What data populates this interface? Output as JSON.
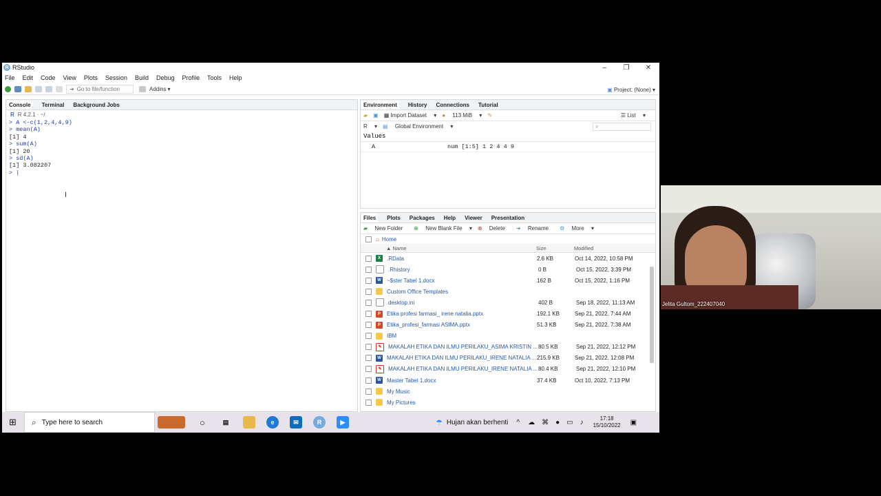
{
  "app": {
    "title": "RStudio",
    "window_controls": [
      "–",
      "❐",
      "✕"
    ],
    "menu": [
      "File",
      "Edit",
      "Code",
      "View",
      "Plots",
      "Session",
      "Build",
      "Debug",
      "Profile",
      "Tools",
      "Help"
    ],
    "toolbar": {
      "go_to_file": "Go to file/function",
      "addins": "Addins",
      "project": "Project: (None)"
    }
  },
  "console_pane": {
    "tabs": [
      "Console",
      "Terminal",
      "Background Jobs"
    ],
    "path": "R 4.2.1 · ~/",
    "lines": [
      {
        "text": "> A <-c(1,2,4,4,9)",
        "type": "in"
      },
      {
        "text": "> mean(A)",
        "type": "in"
      },
      {
        "text": "[1] 4",
        "type": "out"
      },
      {
        "text": "> sum(A)",
        "type": "in"
      },
      {
        "text": "[1] 20",
        "type": "out"
      },
      {
        "text": "> sd(A)",
        "type": "in"
      },
      {
        "text": "[1] 3.082207",
        "type": "out"
      },
      {
        "text": "> |",
        "type": "in"
      }
    ]
  },
  "env_pane": {
    "tabs": [
      "Environment",
      "History",
      "Connections",
      "Tutorial"
    ],
    "import_dataset": "Import Dataset",
    "memory": "113 MiB",
    "list_label": "List",
    "r_label": "R",
    "scope": "Global Environment",
    "section": "Values",
    "rows": [
      {
        "name": "A",
        "value": "num [1:5] 1 2 4 4 9"
      }
    ]
  },
  "files_pane": {
    "tabs": [
      "Files",
      "Plots",
      "Packages",
      "Help",
      "Viewer",
      "Presentation"
    ],
    "actions": [
      "New Folder",
      "New Blank File",
      "Delete",
      "Rename",
      "More"
    ],
    "home": "Home",
    "headers": {
      "name": "Name",
      "size": "Size",
      "modified": "Modified"
    },
    "rows": [
      {
        "name": ".RData",
        "size": "2.6 KB",
        "modified": "Oct 14, 2022, 10:58 PM",
        "icon": "excel"
      },
      {
        "name": ".Rhistory",
        "size": "0 B",
        "modified": "Oct 15, 2022, 3:39 PM",
        "icon": "txt"
      },
      {
        "name": "~$ster Tabel 1.docx",
        "size": "162 B",
        "modified": "Oct 15, 2022, 1:16 PM",
        "icon": "word"
      },
      {
        "name": "Custom Office Templates",
        "size": "",
        "modified": "",
        "icon": "folder"
      },
      {
        "name": "desktop.ini",
        "size": "402 B",
        "modified": "Sep 18, 2022, 11:13 AM",
        "icon": "txt"
      },
      {
        "name": "Etika profesi farmasi_ irene natalia.pptx",
        "size": "192.1 KB",
        "modified": "Sep 21, 2022, 7:44 AM",
        "icon": "ppt"
      },
      {
        "name": "Etika_profesi_farmasi ASIMA.pptx",
        "size": "51.3 KB",
        "modified": "Sep 21, 2022, 7:38 AM",
        "icon": "ppt"
      },
      {
        "name": "IBM",
        "size": "",
        "modified": "",
        "icon": "folder"
      },
      {
        "name": "MAKALAH ETIKA DAN ILMU PERILAKU_ASIMA KRISTIN ...",
        "size": "80.5 KB",
        "modified": "Sep 21, 2022, 12:12 PM",
        "icon": "pdf"
      },
      {
        "name": "MAKALAH ETIKA DAN ILMU PERILAKU_IRENE NATALIA ...",
        "size": "215.9 KB",
        "modified": "Sep 21, 2022, 12:08 PM",
        "icon": "word"
      },
      {
        "name": "MAKALAH ETIKA DAN ILMU PERILAKU_IRENE NATALIA ...",
        "size": "80.4 KB",
        "modified": "Sep 21, 2022, 12:10 PM",
        "icon": "pdf"
      },
      {
        "name": "Master Tabel 1.docx",
        "size": "37.4 KB",
        "modified": "Oct 10, 2022, 7:13 PM",
        "icon": "word"
      },
      {
        "name": "My Music",
        "size": "",
        "modified": "",
        "icon": "folder"
      },
      {
        "name": "My Pictures",
        "size": "",
        "modified": "",
        "icon": "folder"
      }
    ]
  },
  "taskbar": {
    "search_placeholder": "Type here to search",
    "weather": "Hujan akan berhenti",
    "time": "17:18",
    "date": "15/10/2022"
  },
  "video": {
    "participant": "Jelita Gultom_222407040"
  },
  "colors": {
    "accent": "#75aadb",
    "link": "#2359a8",
    "console_input": "#1a3ca8"
  }
}
